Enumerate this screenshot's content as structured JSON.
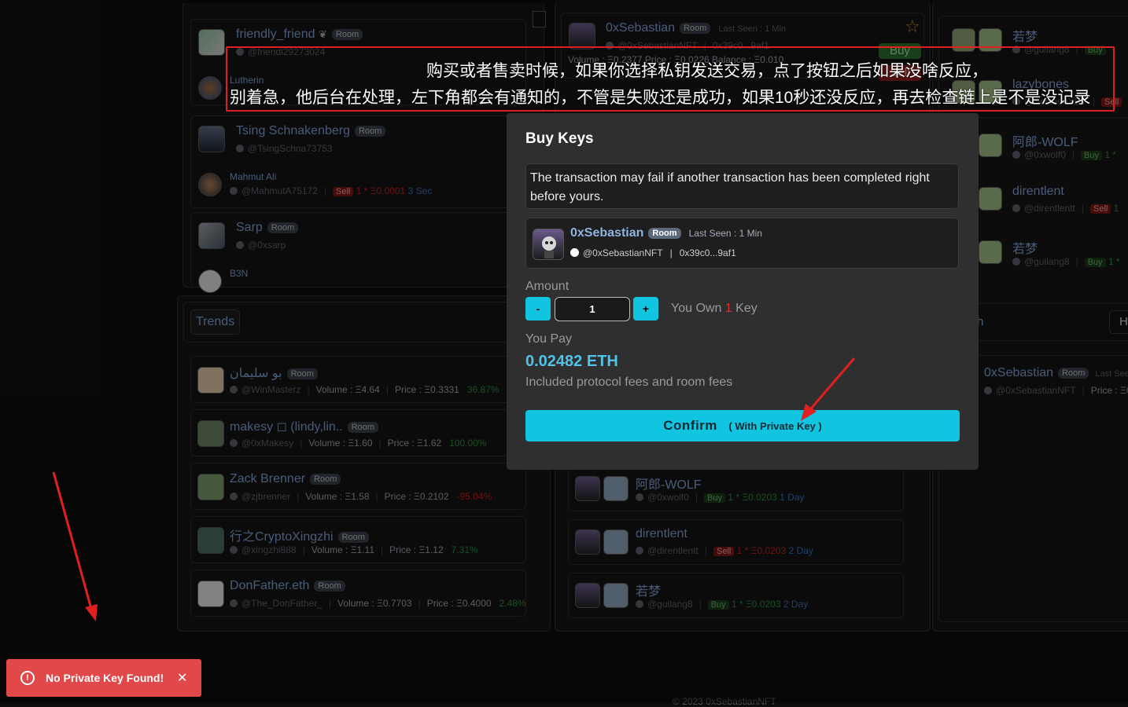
{
  "left_panel": {
    "users": [
      {
        "name": "friendly_friend",
        "room": "Room",
        "handle": "@friendl29273024"
      },
      {
        "name": "Lutherin"
      },
      {
        "name": "Tsing Schnakenberg",
        "room": "Room",
        "handle": "@TsingSchna73753"
      },
      {
        "name": "Mahmut Ali",
        "handle": "@MahmutA75172",
        "tag": "Sell",
        "trade": "1 * Ξ0.0001",
        "time": "3 Sec"
      },
      {
        "name": "Sarp",
        "room": "Room",
        "handle": "@0xsarp"
      },
      {
        "name": "B3N"
      }
    ]
  },
  "trends": {
    "title": "Trends",
    "volume_label": "Volume :",
    "price_label": "Price :",
    "items": [
      {
        "name": "بو سليمان",
        "room": "Room",
        "handle": "@WinMasterz",
        "volume": "Ξ4.64",
        "price": "Ξ0.3331",
        "change": "36.87%",
        "dir": "up"
      },
      {
        "name": "makesy ◻ (lindy,lin..",
        "room": "Room",
        "handle": "@0xMakesy",
        "volume": "Ξ1.60",
        "price": "Ξ1.62",
        "change": "100.00%",
        "dir": "up"
      },
      {
        "name": "Zack Brenner",
        "room": "Room",
        "handle": "@zjbrenner",
        "volume": "Ξ1.58",
        "price": "Ξ0.2102",
        "change": "-95.04%",
        "dir": "down"
      },
      {
        "name": "行之CryptoXingzhi",
        "room": "Room",
        "handle": "@xingzhi888",
        "volume": "Ξ1.11",
        "price": "Ξ1.12",
        "change": "7.31%",
        "dir": "up"
      },
      {
        "name": "DonFather.eth",
        "room": "Room",
        "handle": "@The_DonFather_",
        "volume": "Ξ0.7703",
        "price": "Ξ0.4000",
        "change": "2.48%",
        "dir": "up"
      }
    ]
  },
  "middle_panel": {
    "top_card": {
      "name": "0xSebastian",
      "room": "Room",
      "last_seen": "Last Seen : 1 Min",
      "handle": "@0xSebastianNFT",
      "address": "0x39c0...9af1",
      "buy_label": "Buy",
      "sell_label": "Sell",
      "stats": "Volume : Ξ0.2377   Price : Ξ0.0226   Balance : Ξ0.010"
    },
    "activity": [
      {
        "name": "阿郎-WOLF",
        "handle": "@0xwolf0",
        "tag": "Buy",
        "trade": "1 * Ξ0.0203",
        "time": "1 Day"
      },
      {
        "name": "direntlent",
        "handle": "@direntlentt",
        "tag": "Sell",
        "trade": "1 * Ξ0.0203",
        "time": "2 Day"
      },
      {
        "name": "若梦",
        "handle": "@guilang8",
        "tag": "Buy",
        "trade": "1 * Ξ0.0203",
        "time": "2 Day"
      }
    ]
  },
  "right_panel": {
    "items": [
      {
        "name": "若梦",
        "handle": "@guilang8",
        "tag": "Buy"
      },
      {
        "name": "lazybones",
        "handle": "@SolitudeXBT",
        "tag": "Sell"
      },
      {
        "name": "阿郎-WOLF",
        "handle": "@0xwolf0",
        "tag": "Buy",
        "trade": "1 *"
      },
      {
        "name": "direntlent",
        "handle": "@direntlentt",
        "tag": "Sell",
        "trade": "1"
      },
      {
        "name": "若梦",
        "handle": "@guilang8",
        "tag": "Buy",
        "trade": "1 *"
      }
    ],
    "bottom_card": {
      "name": "0xSebastian",
      "room": "Room",
      "last_seen": "Last See",
      "handle": "@0xSebastianNFT",
      "price": "Price : Ξ0."
    },
    "tab_fragment": "h",
    "tab_fragment2": "H"
  },
  "modal": {
    "title": "Buy Keys",
    "notice": "The transaction may fail if another transaction has been completed right before yours.",
    "user": {
      "name": "0xSebastian",
      "room": "Room",
      "last_seen": "Last Seen : 1 Min",
      "handle": "@0xSebastianNFT",
      "address": "0x39c0...9af1"
    },
    "amount_label": "Amount",
    "minus": "-",
    "plus": "+",
    "amount_value": "1",
    "own_prefix": "You Own",
    "own_count": "1",
    "own_suffix": "Key",
    "pay_label": "You Pay",
    "pay_value": "0.02482 ETH",
    "fees_note": "Included protocol fees and room fees",
    "confirm_label": "Confirm",
    "confirm_sub": "( With Private Key )"
  },
  "annotation": {
    "line1": "购买或者售卖时候，如果你选择私钥发送交易，点了按钮之后如果没啥反应，",
    "line2": "别着急，他后台在处理，左下角都会有通知的，不管是失败还是成功，如果10秒还没反应，再去检查链上是不是没记录"
  },
  "toast": {
    "message": "No Private Key Found!",
    "close": "✕",
    "icon": "!"
  },
  "footer": {
    "text": "© 2023  0xSebastianNFT"
  },
  "colors": {
    "accent": "#11c5e0",
    "annotation_red": "#e02020",
    "toast_bg": "#e0484a",
    "name_blue": "#7c9fd0"
  }
}
